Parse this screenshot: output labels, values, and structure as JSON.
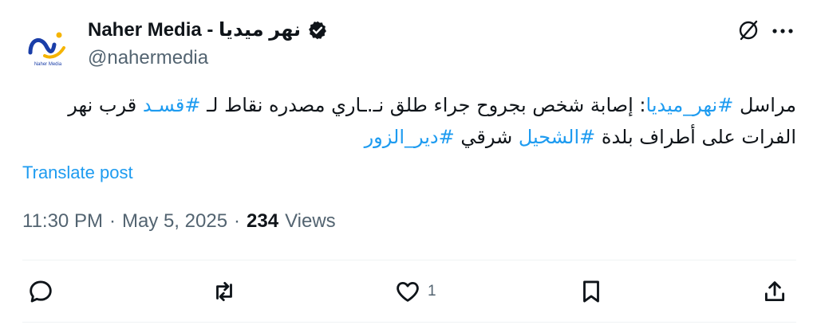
{
  "account": {
    "display_name": "Naher Media - نهر ميديا",
    "handle": "@nahermedia",
    "logo_text": "Naher Media",
    "verified": true
  },
  "tweet": {
    "segments": [
      {
        "text": "مراسل ",
        "type": "plain"
      },
      {
        "text": "#نهر_ميديا",
        "type": "hashtag"
      },
      {
        "text": ": إصابة شخص بجروح جراء طلق نـ.ـاري مصدره نقاط لـ ",
        "type": "plain"
      },
      {
        "text": "#قسـد",
        "type": "hashtag"
      },
      {
        "text": " قرب نهر الفرات على أطراف بلدة ",
        "type": "plain"
      },
      {
        "text": "#الشحيل",
        "type": "hashtag"
      },
      {
        "text": " شرقي ",
        "type": "plain"
      },
      {
        "text": "#دير_الزور",
        "type": "hashtag"
      }
    ],
    "translate_label": "Translate post"
  },
  "meta": {
    "time": "11:30 PM",
    "separator": "·",
    "date": "May 5, 2025",
    "views_count": "234",
    "views_label": "Views"
  },
  "actions": {
    "reply_icon": "reply-icon",
    "retweet_icon": "retweet-icon",
    "like_icon": "heart-icon",
    "like_count": "1",
    "bookmark_icon": "bookmark-icon",
    "share_icon": "share-icon"
  },
  "colors": {
    "accent": "#1d9bf0",
    "text": "#0f1419",
    "secondary": "#536471",
    "divider": "#eff3f4",
    "logo_blue": "#1a3ea8",
    "logo_gold": "#f5b400"
  }
}
